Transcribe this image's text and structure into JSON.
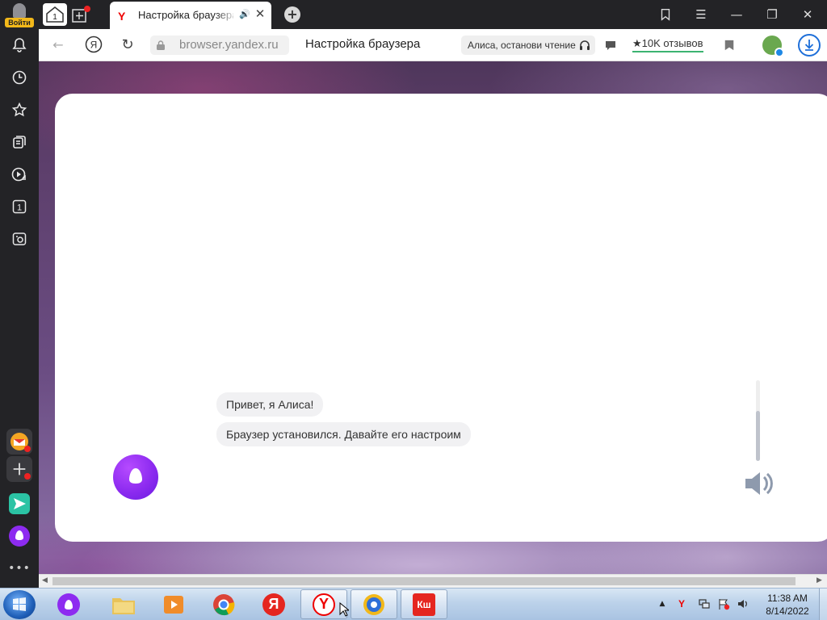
{
  "sidebar": {
    "signin_label": "Войти",
    "tab_count": "1"
  },
  "tabs": {
    "home_counter": "1",
    "active_title": "Настройка браузера",
    "favicon": "Y",
    "close_symbol": "✕",
    "audio_symbol": "🔊"
  },
  "window_controls": {
    "minimize": "—",
    "restore": "❐",
    "close": "✕",
    "menu": "☰"
  },
  "toolbar": {
    "url": "browser.yandex.ru",
    "page_title": "Настройка браузера",
    "alice_read_label": "Алиса, останови чтение",
    "reviews_label": "10K отзывов",
    "back_symbol": "←",
    "yandex_symbol": "Я",
    "reload_symbol": "↻"
  },
  "chat": {
    "messages": [
      "Привет, я Алиса!",
      "Браузер установился. Давайте его настроим"
    ]
  },
  "taskbar": {
    "time": "11:38 AM",
    "date": "8/14/2022",
    "apps": [
      {
        "name": "alice",
        "label": ""
      },
      {
        "name": "explorer",
        "label": ""
      },
      {
        "name": "media-player",
        "label": ""
      },
      {
        "name": "chrome",
        "label": ""
      },
      {
        "name": "yandex",
        "label": "Я"
      },
      {
        "name": "yandex-browser",
        "label": "Y"
      },
      {
        "name": "vpn",
        "label": ""
      },
      {
        "name": "kl",
        "label": "Кш"
      }
    ],
    "tray_yandex": "Y"
  },
  "colors": {
    "accent_blue": "#1e6fd9",
    "alice_purple": "#8d2bf0",
    "signin_yellow": "#f2b81a",
    "reviews_green": "#3cb371"
  }
}
